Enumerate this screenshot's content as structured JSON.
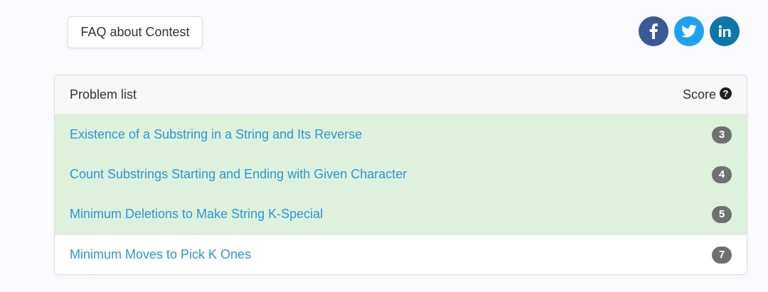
{
  "faq": {
    "label": "FAQ about Contest"
  },
  "social": {
    "facebook": {
      "icon": "facebook-icon",
      "color": "#3b5998"
    },
    "twitter": {
      "icon": "twitter-icon",
      "color": "#1da1f2"
    },
    "linkedin": {
      "icon": "linkedin-icon",
      "color": "#0e76a8"
    }
  },
  "table": {
    "header": {
      "title": "Problem list",
      "score_label": "Score",
      "help_glyph": "?"
    },
    "rows": [
      {
        "title": "Existence of a Substring in a String and Its Reverse",
        "score": "3",
        "status": "solved"
      },
      {
        "title": "Count Substrings Starting and Ending with Given Character",
        "score": "4",
        "status": "solved"
      },
      {
        "title": "Minimum Deletions to Make String K-Special",
        "score": "5",
        "status": "solved"
      },
      {
        "title": "Minimum Moves to Pick K Ones",
        "score": "7",
        "status": "unsolved"
      }
    ],
    "colors": {
      "solved_bg": "#ddf1dc",
      "link": "#2e96d6",
      "badge": "#707070"
    }
  }
}
